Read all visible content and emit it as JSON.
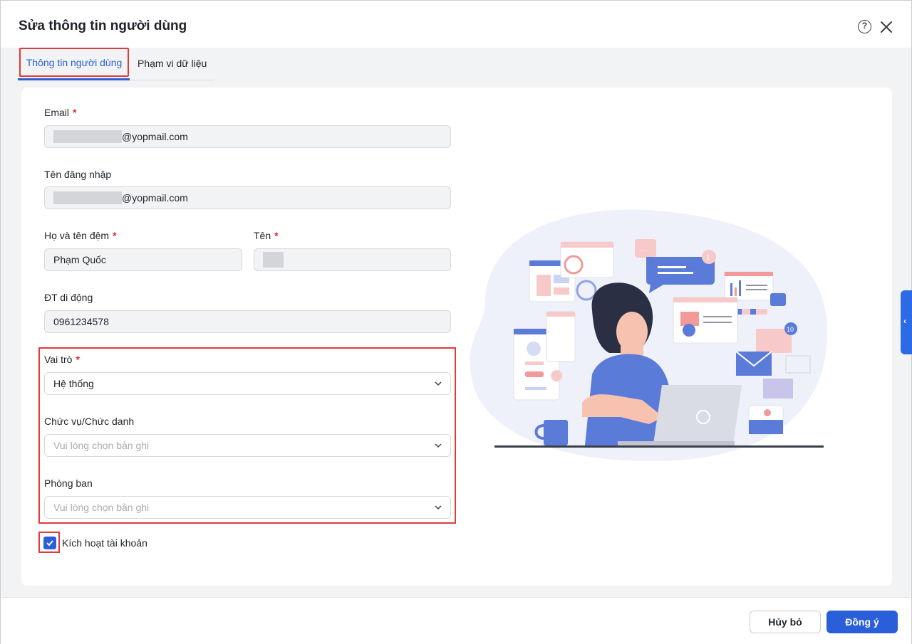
{
  "dialog": {
    "title": "Sửa thông tin người dùng",
    "help_icon": "help-circle-icon",
    "close_icon": "close-icon"
  },
  "tabs": [
    {
      "label": "Thông tin người dùng",
      "active": true
    },
    {
      "label": "Phạm vi dữ liệu",
      "active": false
    }
  ],
  "form": {
    "email": {
      "label": "Email",
      "required": true,
      "value": "@yopmail.com"
    },
    "username": {
      "label": "Tên đăng nhập",
      "value": "@yopmail.com"
    },
    "middle_name": {
      "label": "Họ và tên đệm",
      "required": true,
      "value": "Phạm Quốc"
    },
    "first_name": {
      "label": "Tên",
      "required": true,
      "value": ""
    },
    "mobile": {
      "label": "ĐT di động",
      "value": "0961234578"
    },
    "role": {
      "label": "Vai trò",
      "required": true,
      "value": "Hệ thống"
    },
    "position": {
      "label": "Chức vụ/Chức danh",
      "placeholder": "Vui lòng chọn bản ghi"
    },
    "department": {
      "label": "Phòng ban",
      "placeholder": "Vui lòng chọn bản ghi"
    },
    "activate": {
      "label": "Kích hoạt tài khoản",
      "checked": true
    }
  },
  "illustration": {
    "notification_count_1": "1",
    "notification_count_2": "10",
    "dots": "..."
  },
  "footer": {
    "cancel_label": "Hủy bỏ",
    "ok_label": "Đồng ý"
  },
  "colors": {
    "accent": "#2b5fd9",
    "highlight": "#e03a3a"
  }
}
